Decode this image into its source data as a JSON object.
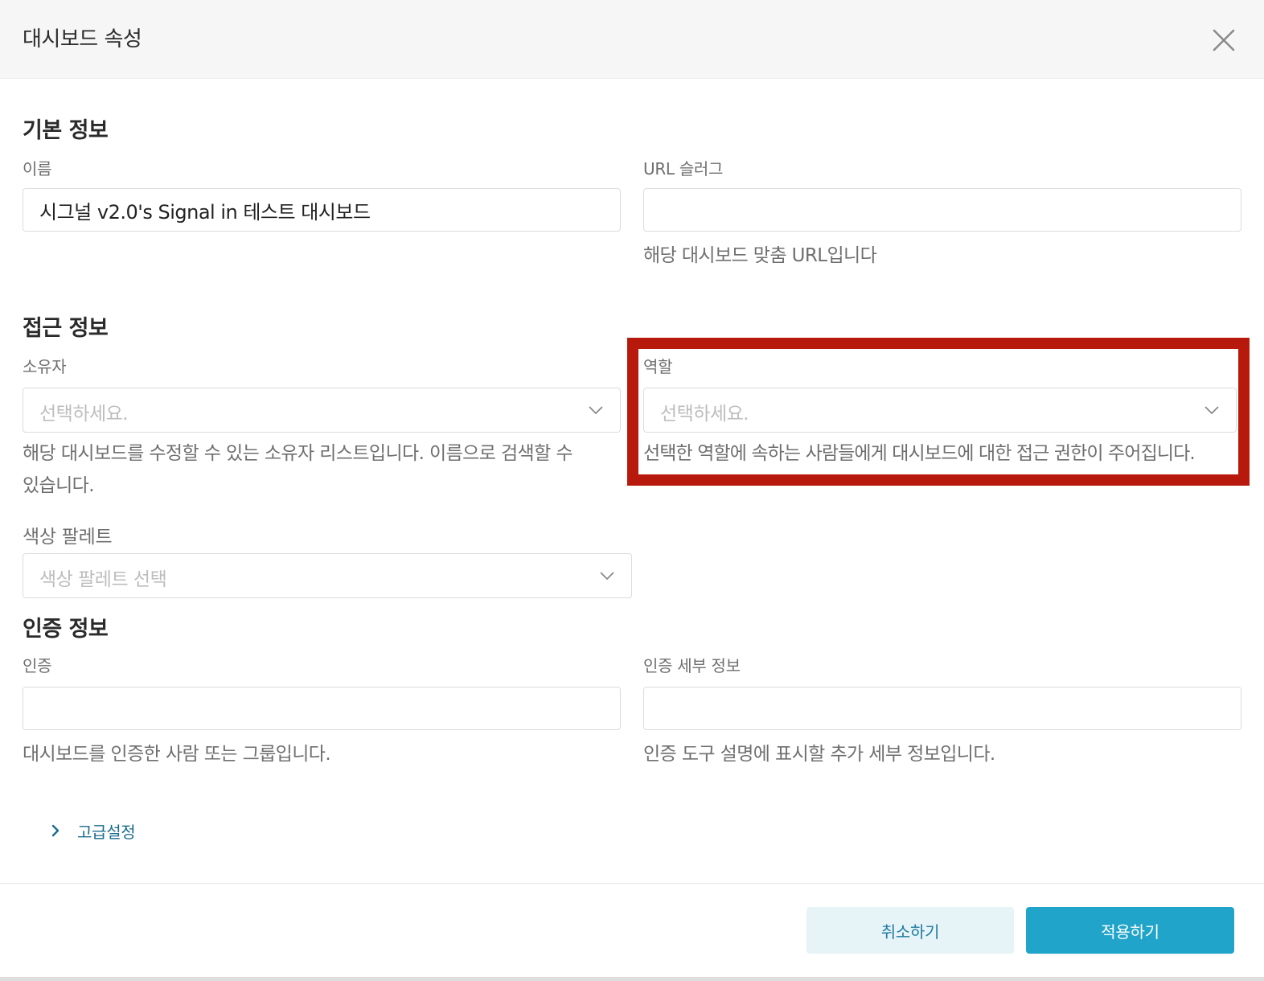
{
  "header": {
    "title": "대시보드 속성"
  },
  "basic": {
    "section_title": "기본 정보",
    "name_label": "이름",
    "name_value": "시그널 v2.0's Signal in 테스트 대시보드",
    "slug_label": "URL 슬러그",
    "slug_value": "",
    "slug_help": "해당 대시보드 맞춤 URL입니다"
  },
  "access": {
    "section_title": "접근 정보",
    "owner_label": "소유자",
    "owner_placeholder": "선택하세요.",
    "owner_help_line1": "해당 대시보드를 수정할 수 있는 소유자 리스트입니다. 이름으로 검색할 수",
    "owner_help_line2": "있습니다.",
    "role_label": "역할",
    "role_placeholder": "선택하세요.",
    "role_help": "선택한 역할에 속하는 사람들에게 대시보드에 대한 접근 권한이 주어집니다.",
    "palette_label": "색상 팔레트",
    "palette_placeholder": "색상 팔레트 선택"
  },
  "cert": {
    "section_title": "인증 정보",
    "cert_label": "인증",
    "cert_value": "",
    "cert_help": "대시보드를 인증한 사람 또는 그룹입니다.",
    "detail_label": "인증 세부 정보",
    "detail_value": "",
    "detail_help": "인증 도구 설명에 표시할 추가 세부 정보입니다."
  },
  "advanced": {
    "label": "고급설정"
  },
  "footer": {
    "cancel_label": "취소하기",
    "apply_label": "적용하기"
  },
  "colors": {
    "accent": "#21a4c9",
    "highlight": "#b71a0c",
    "link": "#1b6c8e"
  },
  "icons": {
    "close": "close-icon",
    "dropdown": "chevron-down-icon",
    "expand": "chevron-right-icon"
  }
}
